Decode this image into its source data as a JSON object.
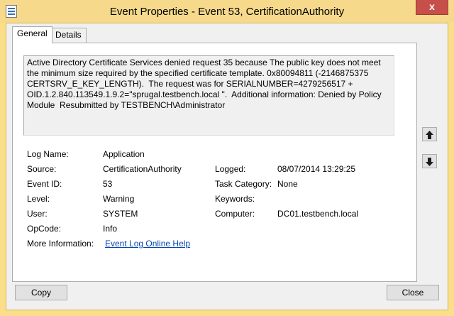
{
  "window": {
    "title": "Event Properties - Event 53, CertificationAuthority",
    "close_glyph": "x"
  },
  "tabs": [
    {
      "label": "General"
    },
    {
      "label": "Details"
    }
  ],
  "description": "Active Directory Certificate Services denied request 35 because The public key does not meet the minimum size required by the specified certificate template. 0x80094811 (-2146875375 CERTSRV_E_KEY_LENGTH).  The request was for SERIALNUMBER=4279256517 + OID.1.2.840.113549.1.9.2=\"sprugal.testbench.local \".  Additional information: Denied by Policy Module  Resubmitted by TESTBENCH\\Administrator",
  "fields": {
    "log_name": {
      "label": "Log Name:",
      "value": "Application"
    },
    "source": {
      "label": "Source:",
      "value": "CertificationAuthority"
    },
    "logged": {
      "label": "Logged:",
      "value": "08/07/2014 13:29:25"
    },
    "event_id": {
      "label": "Event ID:",
      "value": "53"
    },
    "task_category": {
      "label": "Task Category:",
      "value": "None"
    },
    "level": {
      "label": "Level:",
      "value": "Warning"
    },
    "keywords": {
      "label": "Keywords:",
      "value": ""
    },
    "user": {
      "label": "User:",
      "value": "SYSTEM"
    },
    "computer": {
      "label": "Computer:",
      "value": "DC01.testbench.local"
    },
    "opcode": {
      "label": "OpCode:",
      "value": "Info"
    },
    "more_info": {
      "label": "More Information:",
      "link": "Event Log Online Help"
    }
  },
  "buttons": {
    "copy": "Copy",
    "close": "Close"
  },
  "icons": {
    "nav_up": "arrow-up-icon",
    "nav_down": "arrow-down-icon"
  }
}
